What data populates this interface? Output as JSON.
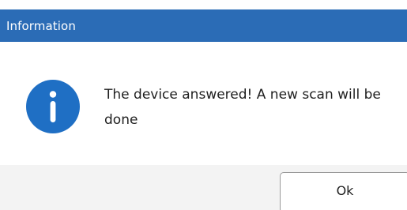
{
  "dialog": {
    "title": "Information",
    "icon": "info-icon",
    "message": "The device answered! A new scan will be done",
    "ok_label": "Ok"
  },
  "colors": {
    "title_bar": "#2b6cb6",
    "icon_fill": "#1f6fc4",
    "footer": "#f3f3f3"
  }
}
